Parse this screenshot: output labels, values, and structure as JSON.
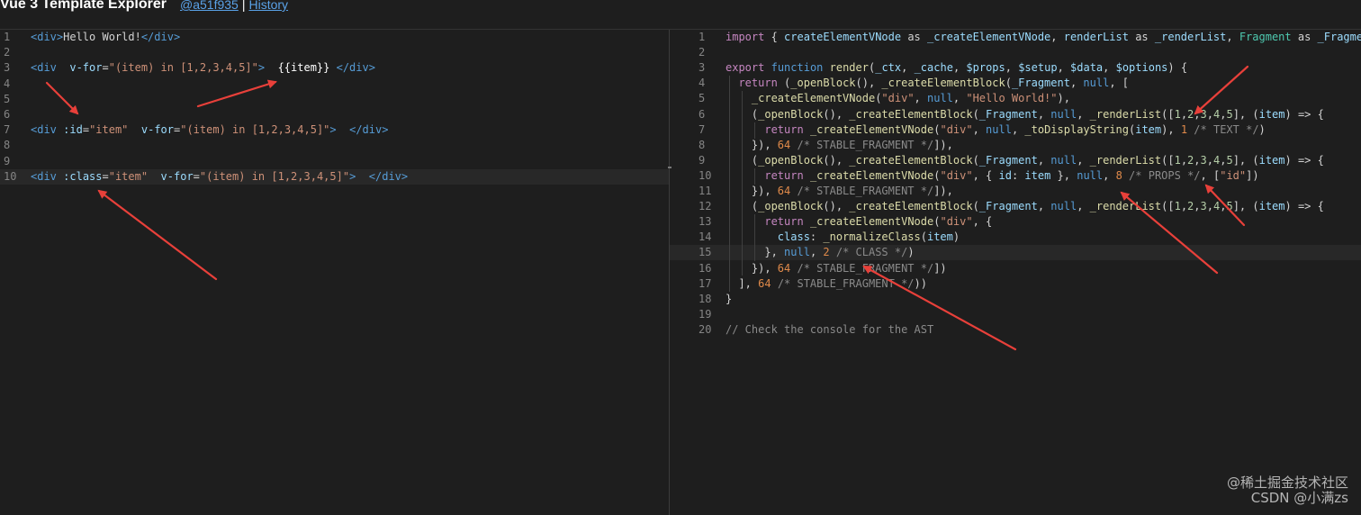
{
  "header": {
    "title": "Vue 3 Template Explorer",
    "commit_link": "@a51f935",
    "separator": "|",
    "history_link": "History"
  },
  "left_editor": {
    "lines": [
      {
        "n": "1",
        "tokens": [
          [
            "c-tag",
            "<div>"
          ],
          [
            "c-plain",
            "Hello World!"
          ],
          [
            "c-tag",
            "</div>"
          ]
        ]
      },
      {
        "n": "2",
        "tokens": []
      },
      {
        "n": "3",
        "tokens": [
          [
            "c-tag",
            "<div"
          ],
          [
            "c-plain",
            "  "
          ],
          [
            "c-attr",
            "v-for"
          ],
          [
            "c-plain",
            "="
          ],
          [
            "c-str",
            "\"(item) in [1,2,3,4,5]\""
          ],
          [
            "c-tag",
            ">"
          ],
          [
            "c-plain",
            "  "
          ],
          [
            "c-white",
            "{{item}}"
          ],
          [
            "c-plain",
            " "
          ],
          [
            "c-tag",
            "</div>"
          ]
        ]
      },
      {
        "n": "4",
        "tokens": []
      },
      {
        "n": "5",
        "tokens": []
      },
      {
        "n": "6",
        "tokens": []
      },
      {
        "n": "7",
        "tokens": [
          [
            "c-tag",
            "<div"
          ],
          [
            "c-plain",
            " "
          ],
          [
            "c-attr",
            ":id"
          ],
          [
            "c-plain",
            "="
          ],
          [
            "c-str",
            "\"item\""
          ],
          [
            "c-plain",
            "  "
          ],
          [
            "c-attr",
            "v-for"
          ],
          [
            "c-plain",
            "="
          ],
          [
            "c-str",
            "\"(item) in [1,2,3,4,5]\""
          ],
          [
            "c-tag",
            ">"
          ],
          [
            "c-plain",
            "  "
          ],
          [
            "c-tag",
            "</div>"
          ]
        ]
      },
      {
        "n": "8",
        "tokens": []
      },
      {
        "n": "9",
        "tokens": []
      },
      {
        "n": "10",
        "tokens": [
          [
            "c-tag",
            "<div"
          ],
          [
            "c-plain",
            " "
          ],
          [
            "c-attr",
            ":class"
          ],
          [
            "c-plain",
            "="
          ],
          [
            "c-str",
            "\"item\""
          ],
          [
            "c-plain",
            "  "
          ],
          [
            "c-attr",
            "v-for"
          ],
          [
            "c-plain",
            "="
          ],
          [
            "c-str",
            "\"(item) in [1,2,3,4,5]\""
          ],
          [
            "c-tag",
            ">"
          ],
          [
            "c-plain",
            "  "
          ],
          [
            "c-tag",
            "</div>"
          ]
        ]
      }
    ]
  },
  "right_editor": {
    "lines": [
      {
        "n": "1",
        "tokens": [
          [
            "c-kw2",
            "import"
          ],
          [
            "c-plain",
            " { "
          ],
          [
            "c-var",
            "createElementVNode"
          ],
          [
            "c-plain",
            " as "
          ],
          [
            "c-var",
            "_createElementVNode"
          ],
          [
            "c-plain",
            ", "
          ],
          [
            "c-var",
            "renderList"
          ],
          [
            "c-plain",
            " as "
          ],
          [
            "c-var",
            "_renderList"
          ],
          [
            "c-plain",
            ", "
          ],
          [
            "c-type",
            "Fragment"
          ],
          [
            "c-plain",
            " as "
          ],
          [
            "c-var",
            "_Fragment"
          ],
          [
            "c-plain",
            ","
          ]
        ]
      },
      {
        "n": "2",
        "tokens": []
      },
      {
        "n": "3",
        "tokens": [
          [
            "c-kw2",
            "export"
          ],
          [
            "c-plain",
            " "
          ],
          [
            "c-kw",
            "function"
          ],
          [
            "c-plain",
            " "
          ],
          [
            "c-fn",
            "render"
          ],
          [
            "c-plain",
            "("
          ],
          [
            "c-var",
            "_ctx"
          ],
          [
            "c-plain",
            ", "
          ],
          [
            "c-var",
            "_cache"
          ],
          [
            "c-plain",
            ", "
          ],
          [
            "c-var",
            "$props"
          ],
          [
            "c-plain",
            ", "
          ],
          [
            "c-var",
            "$setup"
          ],
          [
            "c-plain",
            ", "
          ],
          [
            "c-var",
            "$data"
          ],
          [
            "c-plain",
            ", "
          ],
          [
            "c-var",
            "$options"
          ],
          [
            "c-plain",
            ") {"
          ]
        ]
      },
      {
        "n": "4",
        "tokens": [
          [
            "c-plain",
            "  "
          ],
          [
            "c-kw2",
            "return"
          ],
          [
            "c-plain",
            " ("
          ],
          [
            "c-fn",
            "_openBlock"
          ],
          [
            "c-plain",
            "(), "
          ],
          [
            "c-fn",
            "_createElementBlock"
          ],
          [
            "c-plain",
            "("
          ],
          [
            "c-var",
            "_Fragment"
          ],
          [
            "c-plain",
            ", "
          ],
          [
            "c-kw",
            "null"
          ],
          [
            "c-plain",
            ", ["
          ]
        ]
      },
      {
        "n": "5",
        "tokens": [
          [
            "c-plain",
            "    "
          ],
          [
            "c-fn",
            "_createElementVNode"
          ],
          [
            "c-plain",
            "("
          ],
          [
            "c-str",
            "\"div\""
          ],
          [
            "c-plain",
            ", "
          ],
          [
            "c-kw",
            "null"
          ],
          [
            "c-plain",
            ", "
          ],
          [
            "c-str",
            "\"Hello World!\""
          ],
          [
            "c-plain",
            "),"
          ]
        ]
      },
      {
        "n": "6",
        "tokens": [
          [
            "c-plain",
            "    ("
          ],
          [
            "c-fn",
            "_openBlock"
          ],
          [
            "c-plain",
            "(), "
          ],
          [
            "c-fn",
            "_createElementBlock"
          ],
          [
            "c-plain",
            "("
          ],
          [
            "c-var",
            "_Fragment"
          ],
          [
            "c-plain",
            ", "
          ],
          [
            "c-kw",
            "null"
          ],
          [
            "c-plain",
            ", "
          ],
          [
            "c-fn",
            "_renderList"
          ],
          [
            "c-plain",
            "(["
          ],
          [
            "c-num",
            "1"
          ],
          [
            "c-plain",
            ","
          ],
          [
            "c-num",
            "2"
          ],
          [
            "c-plain",
            ","
          ],
          [
            "c-num",
            "3"
          ],
          [
            "c-plain",
            ","
          ],
          [
            "c-num",
            "4"
          ],
          [
            "c-plain",
            ","
          ],
          [
            "c-num",
            "5"
          ],
          [
            "c-plain",
            "], ("
          ],
          [
            "c-var",
            "item"
          ],
          [
            "c-plain",
            ") => {"
          ]
        ]
      },
      {
        "n": "7",
        "tokens": [
          [
            "c-plain",
            "      "
          ],
          [
            "c-kw2",
            "return"
          ],
          [
            "c-plain",
            " "
          ],
          [
            "c-fn",
            "_createElementVNode"
          ],
          [
            "c-plain",
            "("
          ],
          [
            "c-str",
            "\"div\""
          ],
          [
            "c-plain",
            ", "
          ],
          [
            "c-kw",
            "null"
          ],
          [
            "c-plain",
            ", "
          ],
          [
            "c-fn",
            "_toDisplayString"
          ],
          [
            "c-plain",
            "("
          ],
          [
            "c-var",
            "item"
          ],
          [
            "c-plain",
            "), "
          ],
          [
            "c-orange",
            "1"
          ],
          [
            "c-plain",
            " "
          ],
          [
            "c-cmt2",
            "/* TEXT */"
          ],
          [
            "c-plain",
            ")"
          ]
        ]
      },
      {
        "n": "8",
        "tokens": [
          [
            "c-plain",
            "    }), "
          ],
          [
            "c-orange",
            "64"
          ],
          [
            "c-plain",
            " "
          ],
          [
            "c-cmt2",
            "/* STABLE_FRAGMENT */"
          ],
          [
            "c-plain",
            "]),"
          ]
        ]
      },
      {
        "n": "9",
        "tokens": [
          [
            "c-plain",
            "    ("
          ],
          [
            "c-fn",
            "_openBlock"
          ],
          [
            "c-plain",
            "(), "
          ],
          [
            "c-fn",
            "_createElementBlock"
          ],
          [
            "c-plain",
            "("
          ],
          [
            "c-var",
            "_Fragment"
          ],
          [
            "c-plain",
            ", "
          ],
          [
            "c-kw",
            "null"
          ],
          [
            "c-plain",
            ", "
          ],
          [
            "c-fn",
            "_renderList"
          ],
          [
            "c-plain",
            "(["
          ],
          [
            "c-num",
            "1"
          ],
          [
            "c-plain",
            ","
          ],
          [
            "c-num",
            "2"
          ],
          [
            "c-plain",
            ","
          ],
          [
            "c-num",
            "3"
          ],
          [
            "c-plain",
            ","
          ],
          [
            "c-num",
            "4"
          ],
          [
            "c-plain",
            ","
          ],
          [
            "c-num",
            "5"
          ],
          [
            "c-plain",
            "], ("
          ],
          [
            "c-var",
            "item"
          ],
          [
            "c-plain",
            ") => {"
          ]
        ]
      },
      {
        "n": "10",
        "tokens": [
          [
            "c-plain",
            "      "
          ],
          [
            "c-kw2",
            "return"
          ],
          [
            "c-plain",
            " "
          ],
          [
            "c-fn",
            "_createElementVNode"
          ],
          [
            "c-plain",
            "("
          ],
          [
            "c-str",
            "\"div\""
          ],
          [
            "c-plain",
            ", { "
          ],
          [
            "c-var",
            "id"
          ],
          [
            "c-plain",
            ": "
          ],
          [
            "c-var",
            "item"
          ],
          [
            "c-plain",
            " }, "
          ],
          [
            "c-kw",
            "null"
          ],
          [
            "c-plain",
            ", "
          ],
          [
            "c-orange",
            "8"
          ],
          [
            "c-plain",
            " "
          ],
          [
            "c-cmt2",
            "/* PROPS */"
          ],
          [
            "c-plain",
            ", ["
          ],
          [
            "c-str",
            "\"id\""
          ],
          [
            "c-plain",
            "])"
          ]
        ]
      },
      {
        "n": "11",
        "tokens": [
          [
            "c-plain",
            "    }), "
          ],
          [
            "c-orange",
            "64"
          ],
          [
            "c-plain",
            " "
          ],
          [
            "c-cmt2",
            "/* STABLE_FRAGMENT */"
          ],
          [
            "c-plain",
            "]),"
          ]
        ]
      },
      {
        "n": "12",
        "tokens": [
          [
            "c-plain",
            "    ("
          ],
          [
            "c-fn",
            "_openBlock"
          ],
          [
            "c-plain",
            "(), "
          ],
          [
            "c-fn",
            "_createElementBlock"
          ],
          [
            "c-plain",
            "("
          ],
          [
            "c-var",
            "_Fragment"
          ],
          [
            "c-plain",
            ", "
          ],
          [
            "c-kw",
            "null"
          ],
          [
            "c-plain",
            ", "
          ],
          [
            "c-fn",
            "_renderList"
          ],
          [
            "c-plain",
            "(["
          ],
          [
            "c-num",
            "1"
          ],
          [
            "c-plain",
            ","
          ],
          [
            "c-num",
            "2"
          ],
          [
            "c-plain",
            ","
          ],
          [
            "c-num",
            "3"
          ],
          [
            "c-plain",
            ","
          ],
          [
            "c-num",
            "4"
          ],
          [
            "c-plain",
            ","
          ],
          [
            "c-num",
            "5"
          ],
          [
            "c-plain",
            "], ("
          ],
          [
            "c-var",
            "item"
          ],
          [
            "c-plain",
            ") => {"
          ]
        ]
      },
      {
        "n": "13",
        "tokens": [
          [
            "c-plain",
            "      "
          ],
          [
            "c-kw2",
            "return"
          ],
          [
            "c-plain",
            " "
          ],
          [
            "c-fn",
            "_createElementVNode"
          ],
          [
            "c-plain",
            "("
          ],
          [
            "c-str",
            "\"div\""
          ],
          [
            "c-plain",
            ", {"
          ]
        ]
      },
      {
        "n": "14",
        "tokens": [
          [
            "c-plain",
            "        "
          ],
          [
            "c-var",
            "class"
          ],
          [
            "c-plain",
            ": "
          ],
          [
            "c-fn",
            "_normalizeClass"
          ],
          [
            "c-plain",
            "("
          ],
          [
            "c-var",
            "item"
          ],
          [
            "c-plain",
            ")"
          ]
        ]
      },
      {
        "n": "15",
        "tokens": [
          [
            "c-plain",
            "      }, "
          ],
          [
            "c-kw",
            "null"
          ],
          [
            "c-plain",
            ", "
          ],
          [
            "c-orange",
            "2"
          ],
          [
            "c-plain",
            " "
          ],
          [
            "c-cmt2",
            "/* CLASS */"
          ],
          [
            "c-plain",
            ")"
          ]
        ]
      },
      {
        "n": "16",
        "tokens": [
          [
            "c-plain",
            "    }), "
          ],
          [
            "c-orange",
            "64"
          ],
          [
            "c-plain",
            " "
          ],
          [
            "c-cmt2",
            "/* STABLE_FRAGMENT */"
          ],
          [
            "c-plain",
            "])"
          ]
        ]
      },
      {
        "n": "17",
        "tokens": [
          [
            "c-plain",
            "  ], "
          ],
          [
            "c-orange",
            "64"
          ],
          [
            "c-plain",
            " "
          ],
          [
            "c-cmt2",
            "/* STABLE_FRAGMENT */"
          ],
          [
            "c-plain",
            "))"
          ]
        ]
      },
      {
        "n": "18",
        "tokens": [
          [
            "c-plain",
            "}"
          ]
        ]
      },
      {
        "n": "19",
        "tokens": []
      },
      {
        "n": "20",
        "tokens": [
          [
            "c-cmt2",
            "// Check the console for the AST"
          ]
        ]
      }
    ]
  },
  "watermark": {
    "line1": "@稀土掘金技术社区",
    "line2": "CSDN @小满zs"
  }
}
